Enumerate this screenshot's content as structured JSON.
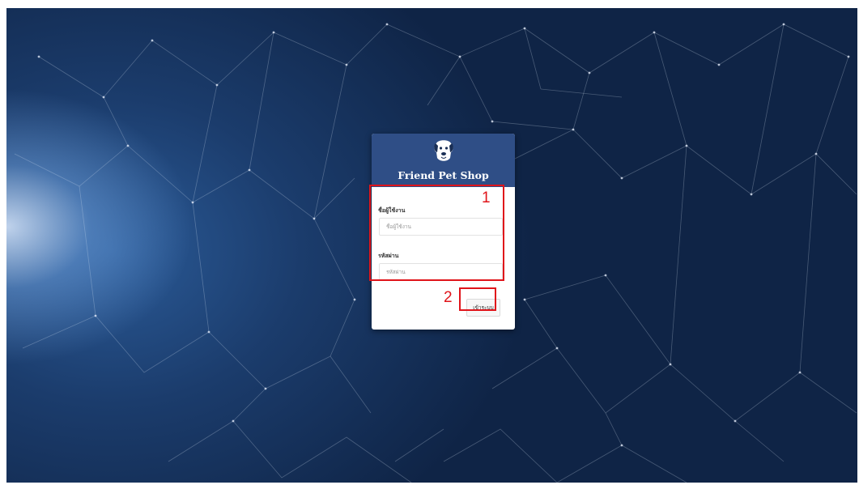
{
  "brand": {
    "name": "Friend Pet Shop",
    "logo_icon": "dog-head-icon"
  },
  "login_form": {
    "username_label": "ชื่อผู้ใช้งาน",
    "username_placeholder": "ชื่อผู้ใช้งาน",
    "password_label": "รหัสผ่าน",
    "password_placeholder": "รหัสผ่าน",
    "submit_label": "เข้าระบบ"
  },
  "annotations": {
    "step_1": "1",
    "step_2": "2",
    "highlight_color": "#e0141a"
  },
  "colors": {
    "header_background": "#2f4e86",
    "page_background": "#0f2446"
  }
}
